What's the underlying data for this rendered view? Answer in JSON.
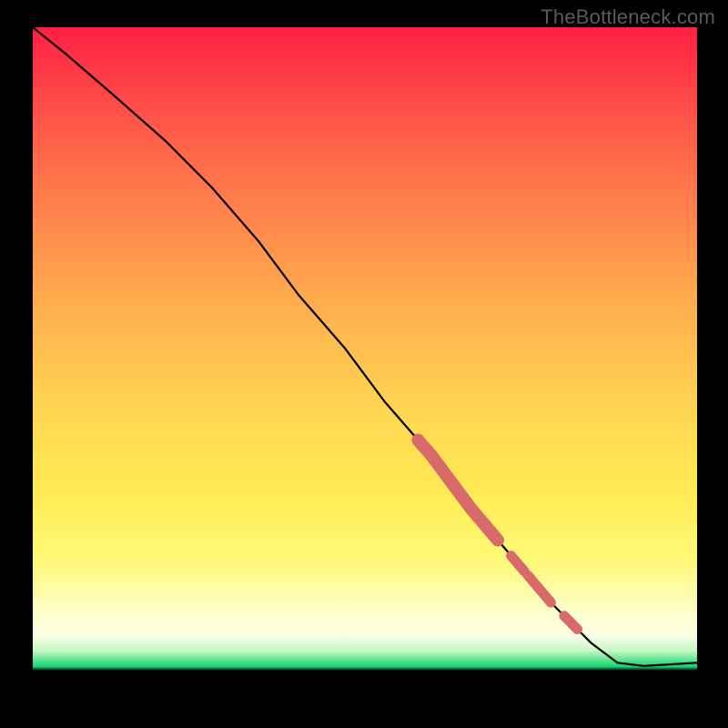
{
  "watermark": "TheBottleneck.com",
  "chart_data": {
    "type": "line",
    "title": "",
    "xlabel": "",
    "ylabel": "",
    "xlim": [
      0,
      100
    ],
    "ylim": [
      0,
      100
    ],
    "gradient_bands_top_to_bottom": [
      "red",
      "orange",
      "yellow",
      "pale-yellow",
      "green",
      "black"
    ],
    "curve_points_xy": [
      [
        0,
        100
      ],
      [
        5,
        96
      ],
      [
        12,
        90
      ],
      [
        20,
        83
      ],
      [
        27,
        76
      ],
      [
        34,
        68
      ],
      [
        40,
        60
      ],
      [
        47,
        52
      ],
      [
        53,
        44
      ],
      [
        60,
        36
      ],
      [
        66,
        28
      ],
      [
        72,
        21
      ],
      [
        78,
        14
      ],
      [
        84,
        8
      ],
      [
        88,
        5
      ],
      [
        92,
        4.5
      ],
      [
        100,
        5
      ]
    ],
    "highlighted_segments_x_range_pct": [
      [
        58,
        70
      ],
      [
        72,
        74
      ],
      [
        74.5,
        78
      ],
      [
        80,
        82
      ]
    ],
    "highlight_color": "#d86a6a",
    "line_color": "#000000"
  }
}
